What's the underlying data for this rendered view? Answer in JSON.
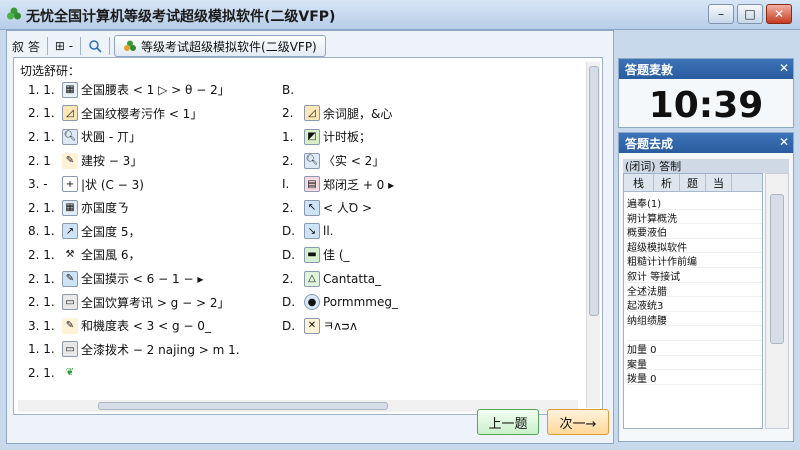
{
  "window": {
    "title": "无忧全国计算机等级考试超级模拟软件(二级VFP)",
    "minimize": "–",
    "maximize": "□",
    "close": "✕"
  },
  "toolbar": {
    "item1": "叙 答",
    "item2": "⊞ -",
    "tab_label": "等级考试超级模拟软件(二级VFP)"
  },
  "question": {
    "title": "切选舒研：",
    "rows": [
      {
        "left_num": "1. 1.",
        "left_text": "全国腰表 < 1 ▷ > θ − 2」",
        "right_num": "B.",
        "right_text": ""
      },
      {
        "left_num": "2. 1.",
        "left_text": "全国纹樱考污作 < 1」",
        "right_num": "2.",
        "right_text": "余词腿，&心"
      },
      {
        "left_num": "2. 1.",
        "left_text": "状圓 - 丌」",
        "right_num": "1.",
        "right_text": "计时板；"
      },
      {
        "left_num": "2. 1",
        "left_text": "建按 − 3」",
        "right_num": "2.",
        "right_text": "〈实 < 2」"
      },
      {
        "left_num": "3. -",
        "left_text": "|状 (C − 3)",
        "right_num": "I.",
        "right_text": "郑闭乏 + 0 ▸"
      },
      {
        "left_num": "2. 1.",
        "left_text": "亦国度ㄋ",
        "right_num": "2.",
        "right_text": "< 人Ꝺ >"
      },
      {
        "left_num": "8. 1.",
        "left_text": "全国度 5，",
        "right_num": "D.",
        "right_text": "ll."
      },
      {
        "left_num": "2. 1.",
        "left_text": "全国風 6，",
        "right_num": "D.",
        "right_text": "佳 (_"
      },
      {
        "left_num": "2. 1.",
        "left_text": "全国摸示 < 6 − 1 − ▸",
        "right_num": "2.",
        "right_text": "Cantatta_"
      },
      {
        "left_num": "2. 1.",
        "left_text": "全国饮算考讯 > g − > 2」",
        "right_num": "D.",
        "right_text": "Pormmmeg_"
      },
      {
        "left_num": "3. 1.",
        "left_text": "和機度表 < 3 < g − 0_",
        "right_num": "D.",
        "right_text": "ㅋᴧᴝᴧ"
      },
      {
        "left_num": "1. 1.",
        "left_text": "全漆拨术 − 2 najing > m 1.",
        "right_num": "",
        "right_text": ""
      },
      {
        "left_num": "2. 1.",
        "left_text": "",
        "right_num": "",
        "right_text": ""
      }
    ],
    "prev_button": "上一题",
    "next_button": "次一→"
  },
  "timer": {
    "header": "答题麦敦",
    "value": "10:39"
  },
  "status": {
    "header": "答题去成",
    "tab_label": "(闭词) 答制",
    "columns": [
      "栈",
      "析",
      "题",
      "当"
    ],
    "rows": [
      "遍奉(1)",
      "朔计算概洗",
      "概要液伯",
      "超级模拟软件",
      "粗糙计计作前编",
      "叙计 等接试",
      "全述法腊",
      "起液统3",
      "纳组绩腰",
      "",
      "加量 0",
      "案量",
      "拨量 0"
    ]
  }
}
